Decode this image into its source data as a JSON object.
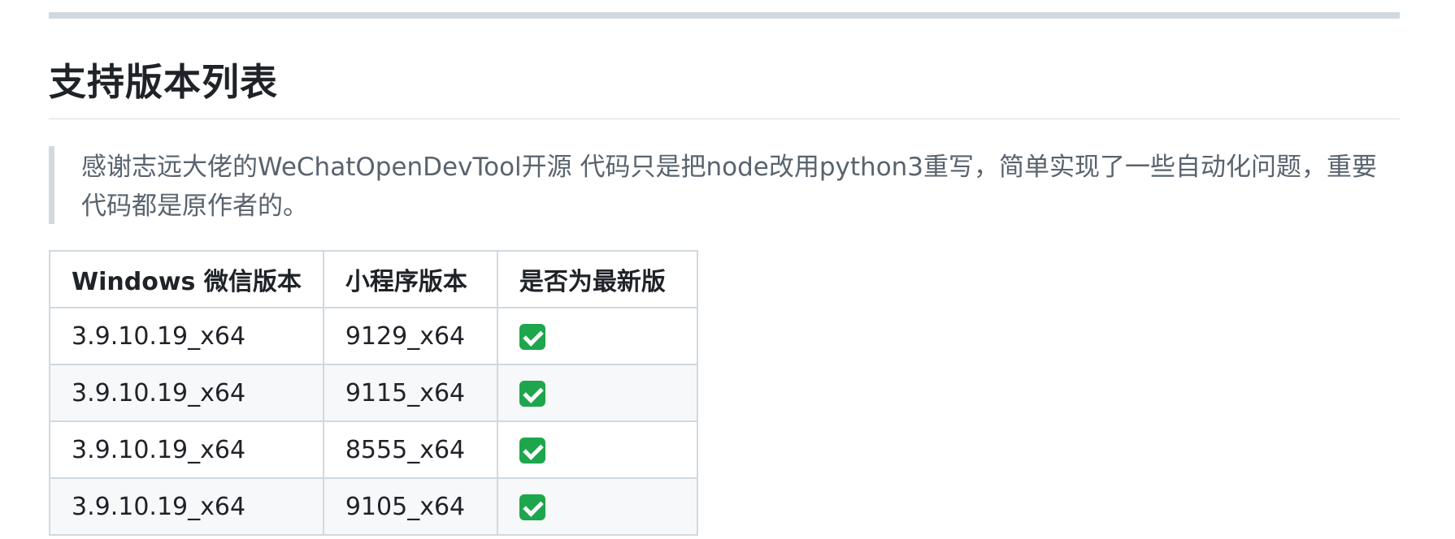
{
  "heading": "支持版本列表",
  "blockquote": "感谢志远大佬的WeChatOpenDevTool开源 代码只是把node改用python3重写，简单实现了一些自动化问题，重要代码都是原作者的。",
  "table": {
    "headers": [
      "Windows 微信版本",
      "小程序版本",
      "是否为最新版"
    ],
    "rows": [
      {
        "wechat": "3.9.10.19_x64",
        "miniprogram": "9129_x64",
        "is_latest": "check-mark-icon"
      },
      {
        "wechat": "3.9.10.19_x64",
        "miniprogram": "9115_x64",
        "is_latest": "check-mark-icon"
      },
      {
        "wechat": "3.9.10.19_x64",
        "miniprogram": "8555_x64",
        "is_latest": "check-mark-icon"
      },
      {
        "wechat": "3.9.10.19_x64",
        "miniprogram": "9105_x64",
        "is_latest": "check-mark-icon"
      }
    ]
  },
  "colors": {
    "check_green": "#1ea64c",
    "border": "#d1d9e0",
    "quote_text": "#59636e"
  }
}
